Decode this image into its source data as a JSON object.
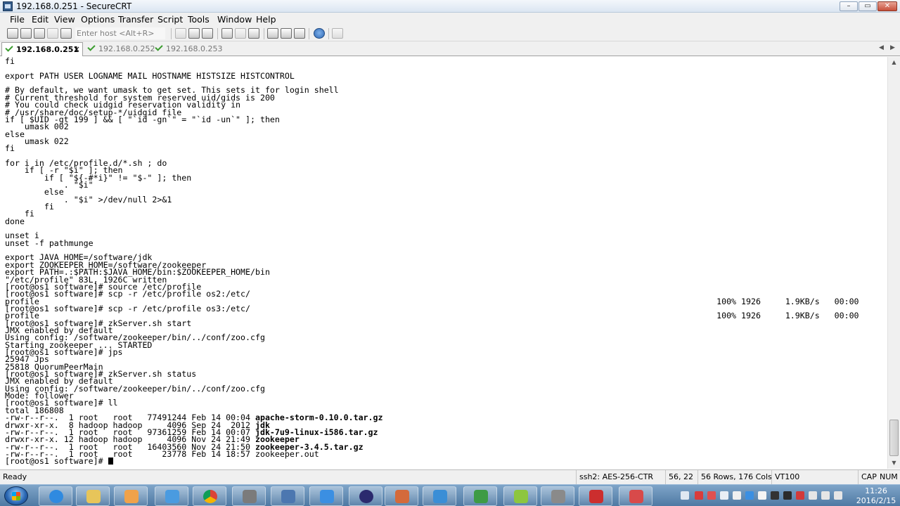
{
  "window": {
    "title": "192.168.0.251 - SecureCRT",
    "minimize_glyph": "–",
    "maximize_glyph": "▭",
    "close_glyph": "✕"
  },
  "menu": [
    "File",
    "Edit",
    "View",
    "Options",
    "Transfer",
    "Script",
    "Tools",
    "Window",
    "Help"
  ],
  "toolbar": {
    "quick_connect_placeholder": "Enter host <Alt+R>"
  },
  "tabs": [
    {
      "label": "192.168.0.251",
      "active": true,
      "close": "×"
    },
    {
      "label": "192.168.0.252",
      "active": false
    },
    {
      "label": "192.168.0.253",
      "active": false
    }
  ],
  "terminal": {
    "lines": [
      "fi",
      "",
      "export PATH USER LOGNAME MAIL HOSTNAME HISTSIZE HISTCONTROL",
      "",
      "# By default, we want umask to get set. This sets it for login shell",
      "# Current threshold for system reserved uid/gids is 200",
      "# You could check uidgid reservation validity in",
      "# /usr/share/doc/setup-*/uidgid file",
      "if [ $UID -gt 199 ] && [ \"`id -gn`\" = \"`id -un`\" ]; then",
      "    umask 002",
      "else",
      "    umask 022",
      "fi",
      "",
      "for i in /etc/profile.d/*.sh ; do",
      "    if [ -r \"$i\" ]; then",
      "        if [ \"${-#*i}\" != \"$-\" ]; then",
      "            . \"$i\"",
      "        else",
      "            . \"$i\" >/dev/null 2>&1",
      "        fi",
      "    fi",
      "done",
      "",
      "unset i",
      "unset -f pathmunge",
      "",
      "export JAVA_HOME=/software/jdk",
      "export ZOOKEEPER_HOME=/software/zookeeper",
      "export PATH=.:$PATH:$JAVA_HOME/bin:$ZOOKEEPER_HOME/bin",
      "\"/etc/profile\" 83L, 1926C written",
      "[root@os1 software]# source /etc/profile",
      "[root@os1 software]# scp -r /etc/profile os2:/etc/",
      "profile                                                                                                                                          100% 1926     1.9KB/s   00:00",
      "[root@os1 software]# scp -r /etc/profile os3:/etc/",
      "profile                                                                                                                                          100% 1926     1.9KB/s   00:00",
      "[root@os1 software]# zkServer.sh start",
      "JMX enabled by default",
      "Using config: /software/zookeeper/bin/../conf/zoo.cfg",
      "Starting zookeeper ... STARTED",
      "[root@os1 software]# jps",
      "25947 Jps",
      "25818 QuorumPeerMain",
      "[root@os1 software]# zkServer.sh status",
      "JMX enabled by default",
      "Using config: /software/zookeeper/bin/../conf/zoo.cfg",
      "Mode: follower",
      "[root@os1 software]# ll",
      "total 186808"
    ],
    "listing": [
      {
        "meta": "-rw-r--r--.  1 root   root   77491244 Feb 14 00:04 ",
        "name": "apache-storm-0.10.0.tar.gz",
        "bold": true
      },
      {
        "meta": "drwxr-xr-x.  8 hadoop hadoop     4096 Sep 24  2012 ",
        "name": "jdk",
        "bold": true
      },
      {
        "meta": "-rw-r--r--.  1 root   root   97361259 Feb 14 00:07 ",
        "name": "jdk-7u9-linux-i586.tar.gz",
        "bold": true
      },
      {
        "meta": "drwxr-xr-x. 12 hadoop hadoop     4096 Nov 24 21:49 ",
        "name": "zookeeper",
        "bold": true
      },
      {
        "meta": "-rw-r--r--.  1 root   root   16403560 Nov 24 21:50 ",
        "name": "zookeeper-3.4.5.tar.gz",
        "bold": true
      },
      {
        "meta": "-rw-r--r--.  1 root   root      23778 Feb 14 18:57 ",
        "name": "zookeeper.out",
        "bold": false
      }
    ],
    "prompt": "[root@os1 software]# "
  },
  "statusbar": {
    "status": "Ready",
    "encryption": "ssh2: AES-256-CTR",
    "cursor_pos": "56,  22",
    "size": "56 Rows, 176 Cols",
    "emulation": "VT100",
    "caps": "CAP",
    "num": "NUM"
  },
  "taskbar": {
    "time": "11:26",
    "date": "2016/2/15"
  }
}
